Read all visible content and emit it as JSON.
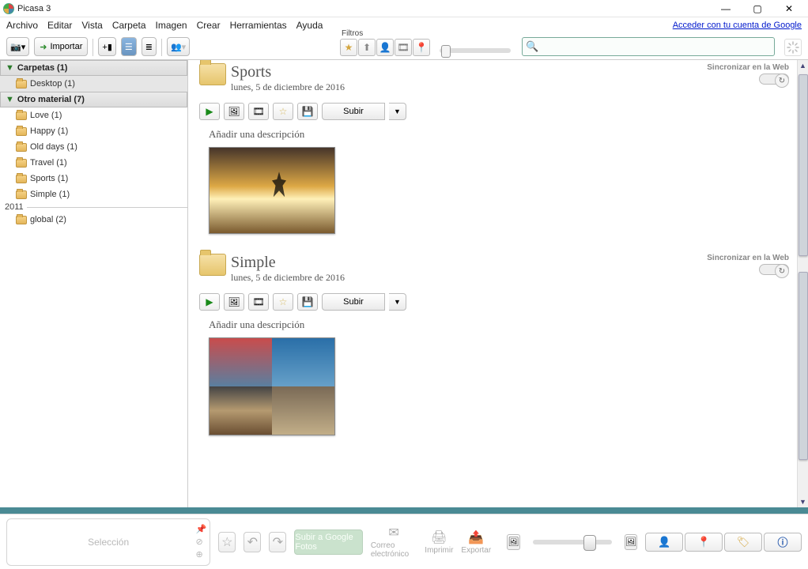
{
  "window": {
    "title": "Picasa 3",
    "login_text": "Acceder con tu cuenta de Google"
  },
  "menu": [
    "Archivo",
    "Editar",
    "Vista",
    "Carpeta",
    "Imagen",
    "Crear",
    "Herramientas",
    "Ayuda"
  ],
  "toolbar": {
    "import_label": "Importar",
    "filters_label": "Filtros",
    "search_placeholder": ""
  },
  "sidebar": {
    "folders_header": "Carpetas (1)",
    "folders": [
      {
        "label": "Desktop (1)"
      }
    ],
    "other_header": "Otro material (7)",
    "other": [
      {
        "label": "Love (1)"
      },
      {
        "label": "Happy (1)"
      },
      {
        "label": "Old days (1)"
      },
      {
        "label": "Travel (1)"
      },
      {
        "label": "Sports (1)"
      },
      {
        "label": "Simple (1)"
      }
    ],
    "year": "2011",
    "year_items": [
      {
        "label": "global (2)"
      }
    ]
  },
  "albums": [
    {
      "name": "Sports",
      "date": "lunes, 5 de diciembre de 2016",
      "upload_label": "Subir",
      "description_prompt": "Añadir una descripción",
      "sync_label": "Sincronizar en la Web"
    },
    {
      "name": "Simple",
      "date": "lunes, 5 de diciembre de 2016",
      "upload_label": "Subir",
      "description_prompt": "Añadir una descripción",
      "sync_label": "Sincronizar en la Web"
    }
  ],
  "bottom": {
    "selection_label": "Selección",
    "upload_google": "Subir a Google Fotos",
    "email": "Correo electrónico",
    "print": "Imprimir",
    "export": "Exportar"
  }
}
